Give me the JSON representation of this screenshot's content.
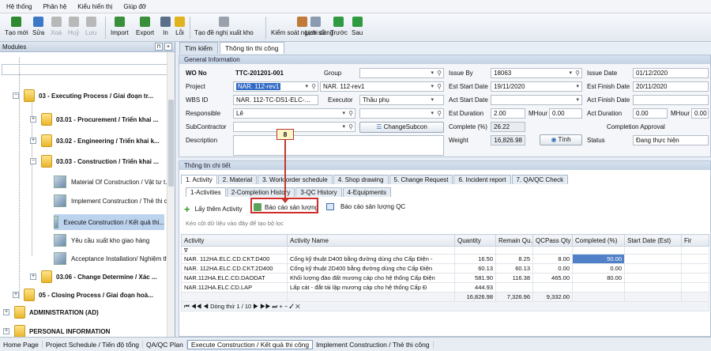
{
  "menu": [
    "Hệ thống",
    "Phân hệ",
    "Kiểu hiển thị",
    "Giúp đỡ"
  ],
  "toolbar": [
    {
      "label": "Tạo mới",
      "icon": "new-icon",
      "enabled": true,
      "color": "#2f8a2f"
    },
    {
      "label": "Sửa",
      "icon": "edit-icon",
      "enabled": true,
      "color": "#3c78c6"
    },
    {
      "label": "Xoá",
      "icon": "delete-icon",
      "enabled": false,
      "color": "#b8b8b8"
    },
    {
      "label": "Huỷ",
      "icon": "cancel-icon",
      "enabled": false,
      "color": "#b8b8b8"
    },
    {
      "label": "Lưu",
      "icon": "save-icon",
      "enabled": false,
      "color": "#b8b8b8"
    },
    {
      "label": "Import",
      "icon": "import-icon",
      "enabled": true,
      "color": "#3a8f3a"
    },
    {
      "label": "Export",
      "icon": "export-icon",
      "enabled": true,
      "color": "#3a8f3a"
    },
    {
      "label": "In",
      "icon": "print-icon",
      "enabled": true,
      "color": "#5a6f8a"
    },
    {
      "label": "Lỗi",
      "icon": "warning-icon",
      "enabled": true,
      "color": "#e0b21c"
    },
    {
      "label": "Tạo đề nghị xuất kho",
      "icon": "gear-icon",
      "enabled": true,
      "color": "#9aa3ad"
    },
    {
      "label": "Kiểm soát người dùng",
      "icon": "user-icon",
      "enabled": true,
      "color": "#c07a3a"
    },
    {
      "label": "Lịch sử",
      "icon": "history-icon",
      "enabled": true,
      "color": "#8a9bb0"
    },
    {
      "label": "Trước",
      "icon": "back-icon",
      "enabled": true,
      "color": "#2f9a3f"
    },
    {
      "label": "Sau",
      "icon": "forward-icon",
      "enabled": true,
      "color": "#2f9a3f"
    }
  ],
  "left": {
    "title": "Modules",
    "tree": [
      {
        "label": "03 - Executing Process / Giai đoạn tr...",
        "bold": true
      },
      {
        "label": "03.01 - Procurement / Triển khai ...",
        "bold": true
      },
      {
        "label": "03.02 - Engineering / Triển khai k...",
        "bold": true
      },
      {
        "label": "03.03 - Construction / Triển khai ...",
        "bold": true
      },
      {
        "label": "Material Of Construction / Vật tư t...",
        "bold": false
      },
      {
        "label": "Implement Construction / Thẻ thi c...",
        "bold": false
      },
      {
        "label": "Execute Construction / Kết quả thi...",
        "bold": false,
        "selected": true
      },
      {
        "label": "Yêu cầu xuất kho giao hàng",
        "bold": false
      },
      {
        "label": "Acceptance Installation/ Nghiệm th...",
        "bold": false
      },
      {
        "label": "03.06 - Change Determine / Xác ...",
        "bold": true
      },
      {
        "label": "05 - Closing Process / Giai đoạn hoà...",
        "bold": true
      },
      {
        "label": "ADMINISTRATION (AD)",
        "bold": true
      },
      {
        "label": "PERSONAL INFORMATION",
        "bold": true
      }
    ]
  },
  "main_tabs": [
    "Tìm kiếm",
    "Thông tin thi công"
  ],
  "general": {
    "title": "General Information",
    "wo_no_label": "WO No",
    "wo_no": "TTC-201201-001",
    "group_label": "Group",
    "group": "",
    "project_label": "Project",
    "project": "NAR. 112-rev1",
    "project2": "NAR. 112-rev1",
    "wbs_label": "WBS ID",
    "wbs": "NAR. 112-TC-DS1-ELC-…",
    "executor_label": "Executor",
    "executor": "Thầu phụ",
    "responsible_label": "Responsible",
    "responsible": "Lê",
    "subcontractor_label": "SubContractor",
    "changesubcon": "ChangeSubcon",
    "description_label": "Description",
    "issue_by_label": "Issue By",
    "issue_by": "18063",
    "issue_date_label": "Issue Date",
    "issue_date": "01/12/2020",
    "est_start_label": "Est Start Date",
    "est_start": "19/11/2020",
    "est_finish_label": "Est Finish Date",
    "est_finish": "20/11/2020",
    "act_start_label": "Act Start Date",
    "act_finish_label": "Act Finish Date",
    "est_duration_label": "Est Duration",
    "est_duration": "2.00",
    "mhour_label": "MHour",
    "mhour1": "0.00",
    "act_duration_label": "Act Duration",
    "act_duration": "0.00",
    "mhour2": "0.00",
    "complete_label": "Complete (%)",
    "complete": "26.22",
    "completion_approval_label": "Completion Approval",
    "weight_label": "Weight",
    "weight": "16,826.98",
    "tinh": "Tính",
    "status_label": "Status",
    "status": "Đang thực hiện"
  },
  "detail": {
    "title": "Thông tin chi tiết",
    "tabs1": [
      "1. Activity",
      "2. Material",
      "3. Work order schedule",
      "4. Shop drawing",
      "5. Change Request",
      "6. Incident report",
      "7. QA/QC Check"
    ],
    "tabs2": [
      "1-Activities",
      "2-Completion History",
      "3-QC History",
      "4-Equipments"
    ],
    "add_activity": "Lấy thêm Activity",
    "report1": "Báo cáo sản lượng",
    "report2": "Báo cáo sản lượng QC",
    "group_hint": "Kéo cột dữ liệu vào đây để tạo bộ lọc",
    "columns": [
      "Activity",
      "Activity Name",
      "Quantity",
      "Remain Qu...",
      "QCPass Qty",
      "Completed (%)",
      "Start Date (Est)",
      "Fir"
    ],
    "rows": [
      [
        "NAR. 112HA.ELC.CD.CKT.D400",
        "Cống kỹ thuật D400  bằng đường dùng cho Cấp Điện -",
        "16.50",
        "8.25",
        "8.00",
        "50.00",
        "",
        ""
      ],
      [
        "NAR. 112HA.ELC.CD.CKT.2D400",
        "Cống kỹ thuật 2D400  bằng đường dùng cho Cấp Điện",
        "60.13",
        "60.13",
        "0.00",
        "0.00",
        "",
        ""
      ],
      [
        "NAR.112HA.ELC.CD.DAODAT",
        "Khối lượng đào đất mương cáp cho hệ thống Cấp Điện",
        "581.90",
        "116.38",
        "465.00",
        "80.00",
        "",
        ""
      ],
      [
        "NAR.112HA.ELC.CD.LAP",
        "Lấp cát - đắt tái lập mương cáp cho hệ thống Cấp Đ",
        "444.93",
        "",
        "",
        "",
        "",
        ""
      ]
    ],
    "totals": [
      "",
      "",
      "16,826.98",
      "7,326.96",
      "9,332.00",
      "",
      "",
      ""
    ],
    "pager": "Dòng thứ 1 / 10"
  },
  "callout": "8",
  "bottom_tabs": [
    "Home Page",
    "Project Schedule / Tiến độ tổng",
    "QA/QC Plan",
    "Execute Construction / Kết quả thi công",
    "Implement Construction / Thẻ thi công"
  ]
}
